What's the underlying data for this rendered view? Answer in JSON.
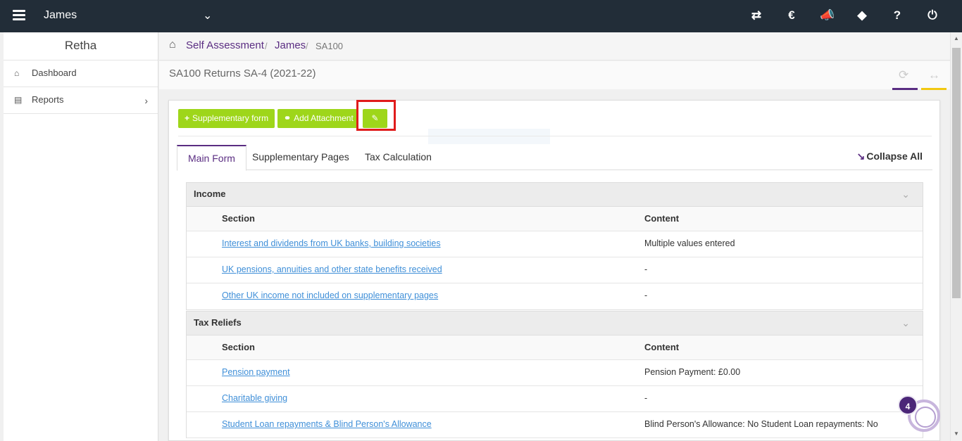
{
  "topbar": {
    "client_name": "James",
    "icons": [
      "menu-icon",
      "chevron-down-icon",
      "switch-icon",
      "currency-icon",
      "announcement-icon",
      "ticket-icon",
      "help-icon",
      "power-icon"
    ]
  },
  "sidebar": {
    "user_name": "Retha",
    "items": [
      {
        "label": "Dashboard",
        "icon": "home-icon"
      },
      {
        "label": "Reports",
        "icon": "document-icon"
      }
    ]
  },
  "breadcrumb": {
    "items": [
      "Self Assessment",
      "James"
    ],
    "current": "SA100"
  },
  "page": {
    "title": "SA100 Returns SA-4 (2021-22)",
    "accent_purple": "#5a2d82",
    "accent_yellow": "#f2c811"
  },
  "toolbar": {
    "supplementary_label": "Supplementary form",
    "attachment_label": "Add Attachment",
    "button_color": "#9ed61a",
    "highlight_color": "#e01b1b"
  },
  "tabs": {
    "items": [
      "Main Form",
      "Supplementary Pages",
      "Tax Calculation"
    ],
    "active": "Main Form",
    "collapse_label": "Collapse All"
  },
  "panels": [
    {
      "title": "Income",
      "headers": [
        "Section",
        "Content"
      ],
      "rows": [
        {
          "section": "Interest and dividends from UK banks, building societies",
          "content": "Multiple values entered"
        },
        {
          "section": "UK pensions, annuities and other state benefits received",
          "content": "-"
        },
        {
          "section": "Other UK income not included on supplementary pages",
          "content": "-"
        }
      ]
    },
    {
      "title": "Tax Reliefs",
      "headers": [
        "Section",
        "Content"
      ],
      "rows": [
        {
          "section": "Pension payment",
          "content": "Pension Payment: £0.00"
        },
        {
          "section": "Charitable giving",
          "content": "-"
        },
        {
          "section": "Student Loan repayments & Blind Person's Allowance",
          "content": "Blind Person's Allowance: No Student Loan repayments: No"
        }
      ]
    }
  ],
  "notification": {
    "count": "4"
  }
}
